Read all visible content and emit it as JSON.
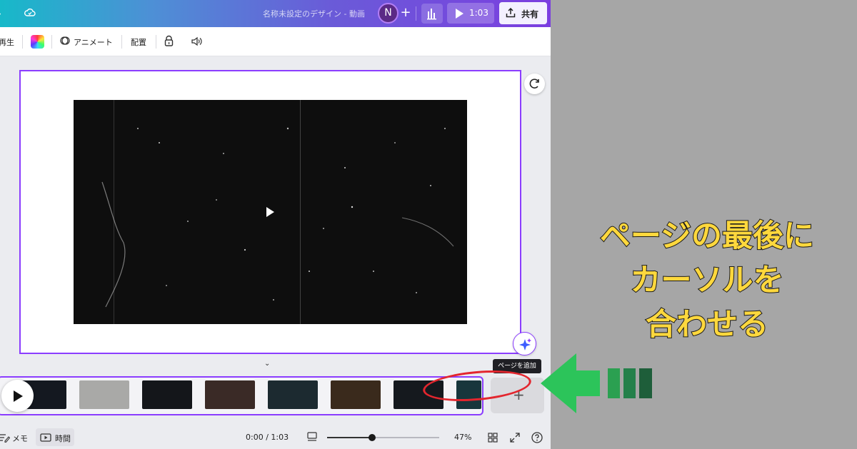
{
  "topbar": {
    "doc_title": "名称未設定のデザイン - 動画",
    "avatar_initial": "N",
    "add_label": "+",
    "present_time": "1:03",
    "share_label": "共有"
  },
  "toolbar": {
    "play_label": "再生",
    "animate_label": "アニメート",
    "position_label": "配置"
  },
  "tooltip": "ページを追加",
  "bottombar": {
    "notes_label": "メモ",
    "timer_label": "時間",
    "time_readout": "0:00 / 1:03",
    "zoom_percent": "47%",
    "zoom_level": 0.4
  },
  "timeline": {
    "thumbnails": [
      {
        "color": "#141820"
      },
      {
        "color": "#a9a9a7"
      },
      {
        "color": "#14161a"
      },
      {
        "color": "#3a2a26"
      },
      {
        "color": "#1c2a30"
      },
      {
        "color": "#3a2a1c"
      },
      {
        "color": "#15191e"
      },
      {
        "color": "#18363c"
      }
    ]
  },
  "annotation": {
    "line1": "ページの最後に",
    "line2": "カーソルを",
    "line3": "合わせる",
    "text_color": "#ffd83d",
    "arrow_color": "#2cc45a",
    "circle_color": "#e3262e"
  },
  "colors": {
    "accent": "#8b3dff"
  }
}
